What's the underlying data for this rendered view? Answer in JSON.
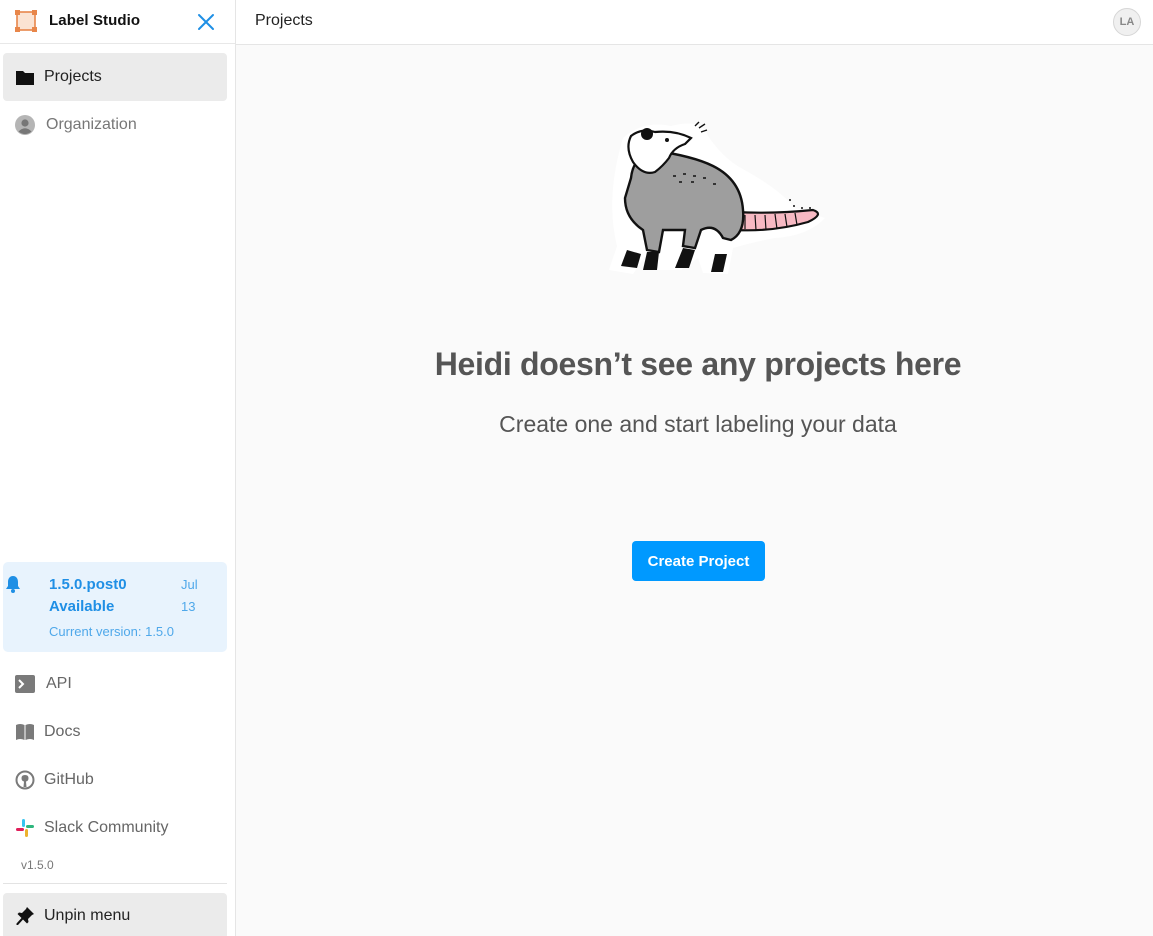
{
  "brand": {
    "name": "Label Studio"
  },
  "sidebar": {
    "nav": [
      {
        "label": "Projects",
        "icon": "folder-icon"
      },
      {
        "label": "Organization",
        "icon": "person-icon"
      }
    ],
    "update": {
      "version_line1": "1.5.0.post0",
      "version_line2": "Available",
      "date_month": "Jul",
      "date_day": "13",
      "current": "Current version: 1.5.0"
    },
    "links": [
      {
        "label": "API",
        "icon": "terminal-icon"
      },
      {
        "label": "Docs",
        "icon": "book-icon"
      },
      {
        "label": "GitHub",
        "icon": "github-icon"
      },
      {
        "label": "Slack Community",
        "icon": "slack-icon"
      }
    ],
    "version_tag": "v1.5.0",
    "unpin_label": "Unpin menu"
  },
  "topbar": {
    "title": "Projects",
    "avatar_initials": "LA"
  },
  "empty_state": {
    "title": "Heidi doesn’t see any projects here",
    "subtitle": "Create one and start labeling your data",
    "button": "Create Project"
  },
  "colors": {
    "accent": "#0099ff",
    "update_bg": "#e8f3fd",
    "update_text": "#1f8fe5"
  }
}
